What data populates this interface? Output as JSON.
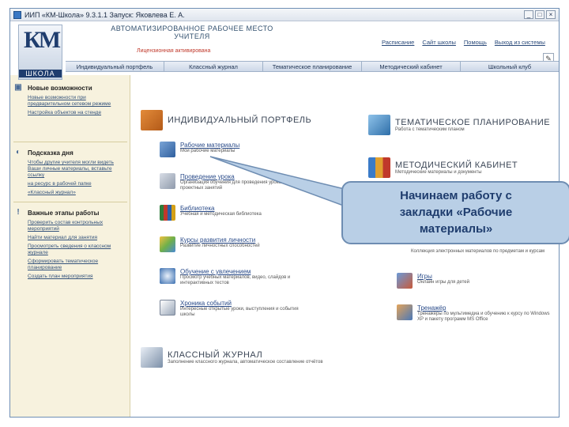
{
  "window": {
    "title": "ИИП «КМ-Школа» 9.3.1.1 Запуск: Яковлева Е. А.",
    "min": "_",
    "max": "□",
    "close": "×"
  },
  "header": {
    "logo_letters": "КМ",
    "logo_school": "ШКОЛА",
    "app_title_1": "АВТОМАТИЗИРОВАННОЕ РАБОЧЕЕ МЕСТО",
    "app_title_2": "УЧИТЕЛЯ",
    "license": "Лицензионная активирована",
    "topnav": [
      "Расписание",
      "Сайт школы",
      "Помощь",
      "Выход из системы"
    ],
    "edit_icon": "✎"
  },
  "tabs": [
    "Индивидуальный портфель",
    "Классный журнал",
    "Тематическое планирование",
    "Методический кабинет",
    "Школьный клуб"
  ],
  "sidebar": {
    "sections": [
      {
        "icon": "▣",
        "title": "Новые возможности",
        "links": [
          "Новые возможности при предварительном сетевом режиме",
          "Настройка объектов на стенде"
        ]
      },
      {
        "icon": "◐",
        "title": "Подсказка дня",
        "links": [
          "Чтобы другие учителя могли видеть Ваши личные материалы, вставьте ссылку",
          "на ресурс в рабочей папке",
          "«Классный журнал»"
        ]
      },
      {
        "icon": "!",
        "title": "Важные этапы работы",
        "links": [
          "Проверить состав контрольных мероприятий",
          "Найти материал для занятия",
          "Просмотреть сведения о классном журнале",
          "Сформировать тематическое планирование",
          "Создать план мероприятия"
        ]
      }
    ]
  },
  "main": {
    "portfolio_title": "ИНДИВИДУАЛЬНЫЙ ПОРТФЕЛЬ",
    "items": [
      {
        "title": "Рабочие материалы",
        "desc": "Мои рабочие материалы"
      },
      {
        "title": "Проведение урока",
        "desc": "Организация обучения для проведения урока и проектных занятий"
      },
      {
        "title": "Библиотека",
        "desc": "Учебная и методическая библиотека"
      },
      {
        "title": "Курсы развития личности",
        "desc": "Развитие личностных способностей"
      },
      {
        "title": "Обучение с увлечением",
        "desc": "Просмотр учебных материалов, видео, слайдов и интерактивных тестов"
      },
      {
        "title": "Хроника событий",
        "desc": "Интересные открытые уроки, выступления и события школы"
      }
    ],
    "journal_title": "КЛАССНЫЙ ЖУРНАЛ",
    "journal_desc": "Заполнение классного журнала, автоматическое составление отчётов",
    "planning_title": "ТЕМАТИЧЕСКОЕ ПЛАНИРОВАНИЕ",
    "planning_desc": "Работа с тематическим планом",
    "methodic_title": "МЕТОДИЧЕСКИЙ КАБИНЕТ",
    "methodic_desc": "Методические материалы и документы",
    "right_items": [
      {
        "title": "",
        "desc": "Коллекция электронных материалов по предметам и курсам"
      },
      {
        "title": "Игры",
        "desc": "Онлайн игры для детей"
      },
      {
        "title": "Тренажёр",
        "desc": "Тренажёры по мультимедиа и обучению к курсу по Windows XP и пакету программ MS Office"
      }
    ]
  },
  "callout": {
    "line1": "Начинаем работу с",
    "line2": "закладки «Рабочие",
    "line3": "материалы»"
  },
  "colors": {
    "accent": "#1f3d6e",
    "callout_bg": "#b9cfe6",
    "sidebar_bg": "#f7f2de"
  }
}
